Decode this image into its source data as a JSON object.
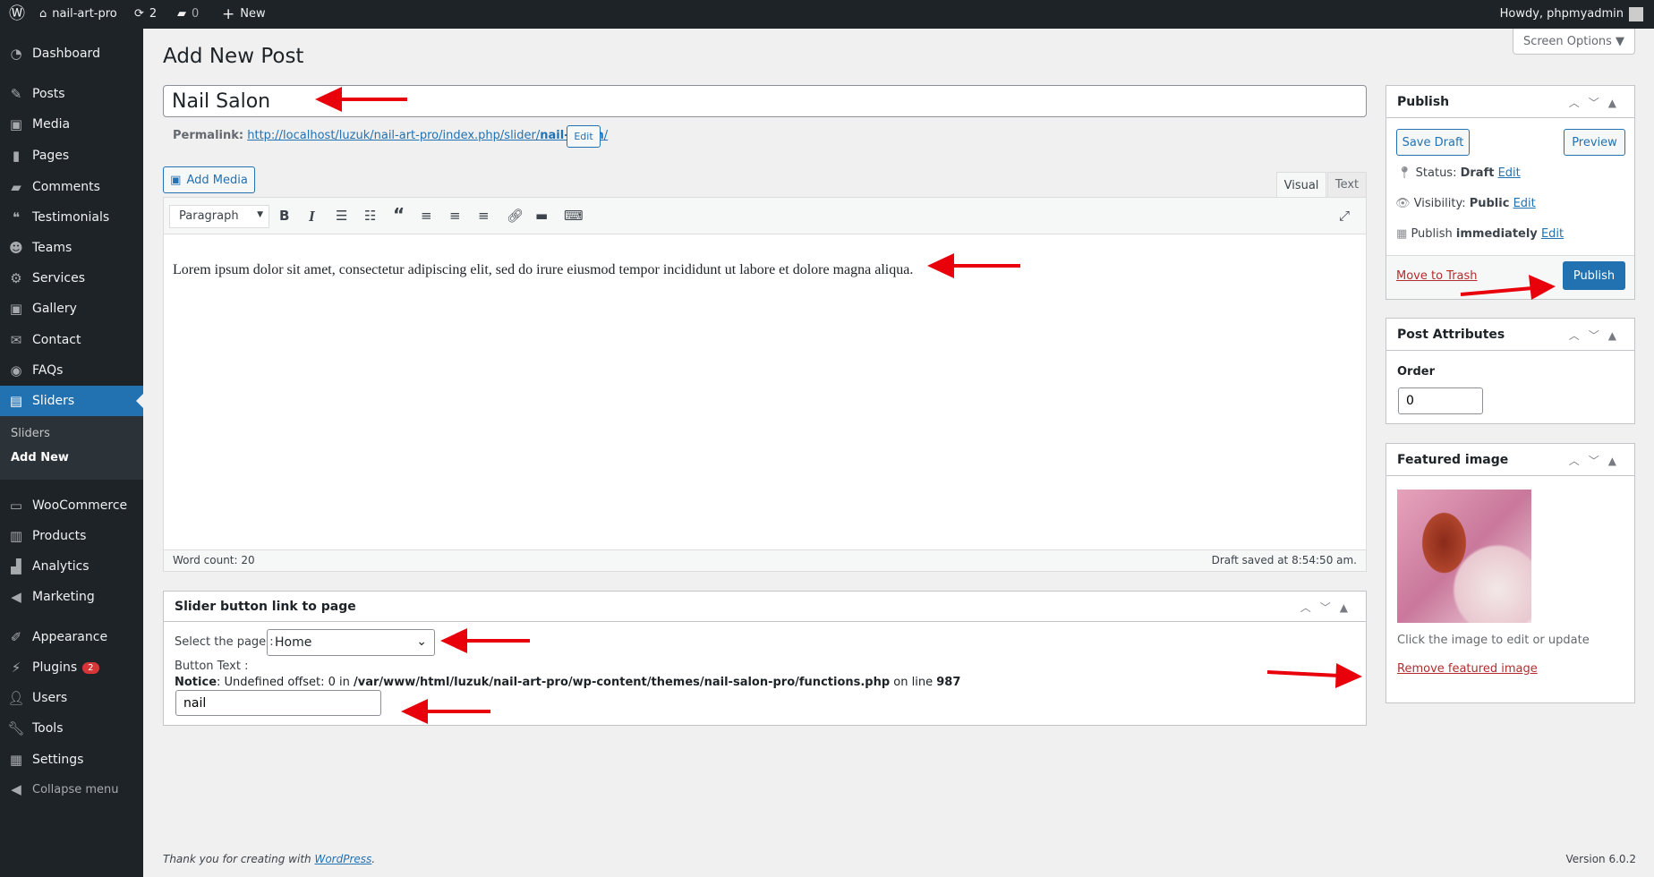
{
  "adminbar": {
    "site": "nail-art-pro",
    "updates": "2",
    "comments": "0",
    "new": "New",
    "howdy": "Howdy, phpmyadmin"
  },
  "sidebar": {
    "items": [
      {
        "label": "Dashboard",
        "icon": "dashboard-icon"
      },
      {
        "label": "Posts",
        "icon": "pin-icon"
      },
      {
        "label": "Media",
        "icon": "media-icon"
      },
      {
        "label": "Pages",
        "icon": "pages-icon"
      },
      {
        "label": "Comments",
        "icon": "comment-icon"
      },
      {
        "label": "Testimonials",
        "icon": "testimonial-icon"
      },
      {
        "label": "Teams",
        "icon": "groups-icon"
      },
      {
        "label": "Services",
        "icon": "services-icon"
      },
      {
        "label": "Gallery",
        "icon": "gallery-icon"
      },
      {
        "label": "Contact",
        "icon": "mail-icon"
      },
      {
        "label": "FAQs",
        "icon": "faq-icon"
      },
      {
        "label": "Sliders",
        "icon": "slides-icon"
      },
      {
        "label": "WooCommerce",
        "icon": "woo-icon"
      },
      {
        "label": "Products",
        "icon": "products-icon"
      },
      {
        "label": "Analytics",
        "icon": "chart-icon"
      },
      {
        "label": "Marketing",
        "icon": "megaphone-icon"
      },
      {
        "label": "Appearance",
        "icon": "brush-icon"
      },
      {
        "label": "Plugins",
        "icon": "plugin-icon",
        "badge": "2"
      },
      {
        "label": "Users",
        "icon": "users-icon"
      },
      {
        "label": "Tools",
        "icon": "tools-icon"
      },
      {
        "label": "Settings",
        "icon": "settings-icon"
      }
    ],
    "submenu": [
      "Sliders",
      "Add New"
    ],
    "collapse": "Collapse menu"
  },
  "page": {
    "title": "Add New Post",
    "screen_options": "Screen Options ▼"
  },
  "post": {
    "title": "Nail Salon",
    "permalink_label": "Permalink:",
    "permalink_base": "http://localhost/luzuk/nail-art-pro/index.php/slider/",
    "permalink_slug": "nail-salon",
    "permalink_end": "/",
    "edit": "Edit"
  },
  "editor": {
    "add_media": "Add Media",
    "tab_visual": "Visual",
    "tab_text": "Text",
    "format": "Paragraph",
    "content": "Lorem ipsum dolor sit amet, consectetur adipiscing elit, sed do irure eiusmod tempor incididunt ut labore et dolore magna aliqua.",
    "word_count": "Word count: 20",
    "draft_saved": "Draft saved at 8:54:50 am."
  },
  "slider_box": {
    "title": "Slider button link to page",
    "select_label": "Select the page :",
    "select_value": "Home",
    "button_text_label": "Button Text :",
    "notice_label": "Notice",
    "notice_text": ": Undefined offset: 0 in ",
    "notice_path": "/var/www/html/luzuk/nail-art-pro/wp-content/themes/nail-salon-pro/functions.php",
    "notice_on": " on line ",
    "notice_line": "987",
    "button_text_value": "nail"
  },
  "publish": {
    "title": "Publish",
    "save_draft": "Save Draft",
    "preview": "Preview",
    "status_label": "Status: ",
    "status": "Draft",
    "visibility_label": "Visibility: ",
    "visibility": "Public",
    "publish_label": "Publish ",
    "publish_when": "immediately",
    "edit": "Edit",
    "trash": "Move to Trash",
    "publish_btn": "Publish"
  },
  "attributes": {
    "title": "Post Attributes",
    "order_label": "Order",
    "order_value": "0"
  },
  "featured": {
    "title": "Featured image",
    "hint": "Click the image to edit or update",
    "remove": "Remove featured image"
  },
  "footer": {
    "thanks": "Thank you for creating with ",
    "wp": "WordPress",
    "period": ".",
    "version": "Version 6.0.2"
  },
  "colors": {
    "accent": "#2271b1",
    "sidebar": "#1d2327",
    "annotation": "#e8000b"
  }
}
